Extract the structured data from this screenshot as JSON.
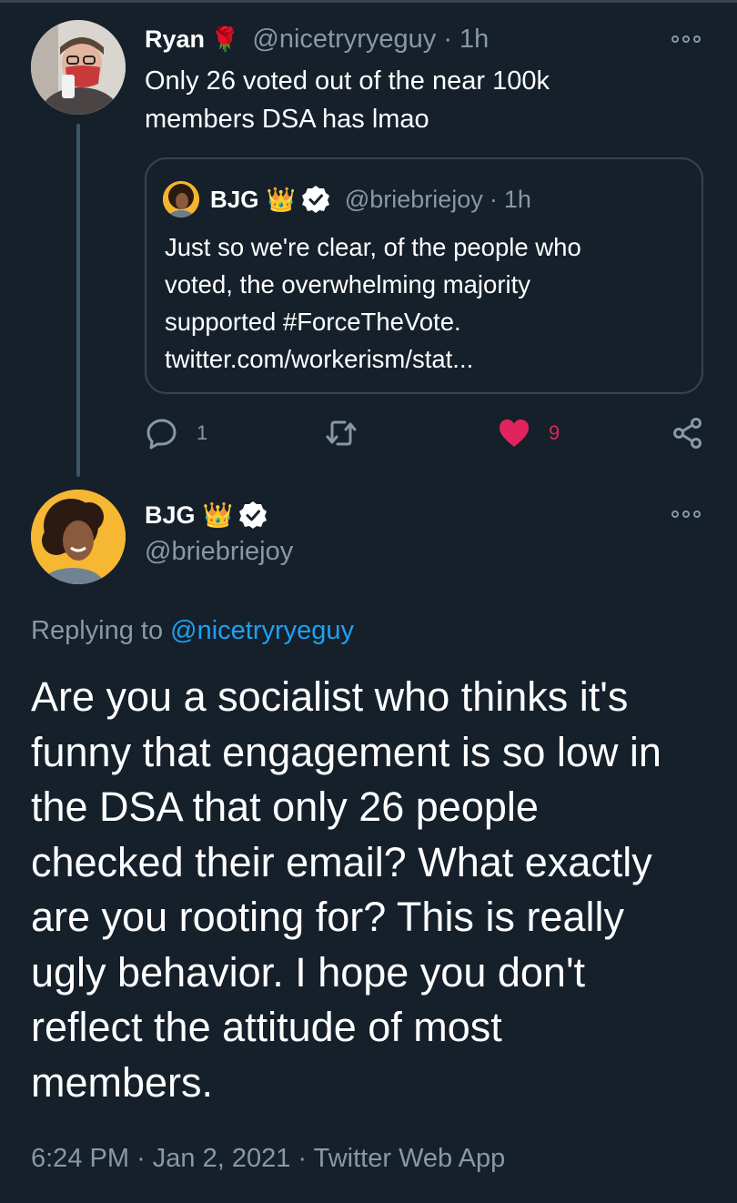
{
  "parent_tweet": {
    "author_name": "Ryan",
    "author_emoji": "🌹",
    "handle": "@nicetryryeguy",
    "time": "1h",
    "text_line1": "Only 26 voted out of the near 100k",
    "text_line2": "members DSA has lmao",
    "actions": {
      "reply_count": "1",
      "like_count": "9"
    }
  },
  "quoted_tweet": {
    "author_name": "BJG",
    "author_emoji": "👑",
    "handle": "@briebriejoy",
    "time": "1h",
    "line1": "Just so we're clear, of the people who",
    "line2": "voted, the overwhelming majority",
    "line3": "supported #ForceTheVote.",
    "line4": "twitter.com/workerism/stat..."
  },
  "main_tweet": {
    "author_name": "BJG",
    "author_emoji": "👑",
    "handle": "@briebriejoy",
    "replying_prefix": "Replying to",
    "replying_handle": "@nicetryryeguy",
    "line1": "Are you a socialist who thinks it's",
    "line2": "funny that engagement is so low in",
    "line3": "the DSA that only 26 people",
    "line4": "checked their email? What exactly",
    "line5": "are you rooting for? This is really",
    "line6": "ugly behavior. I hope you don't",
    "line7": "reflect the attitude of most",
    "line8": "members.",
    "timestamp": "6:24 PM",
    "date": "Jan 2, 2021",
    "source": "Twitter Web App"
  },
  "colors": {
    "background": "#15202b",
    "muted": "#8899a6",
    "link": "#1da1f2",
    "like": "#e0245e",
    "border": "#38444d"
  }
}
